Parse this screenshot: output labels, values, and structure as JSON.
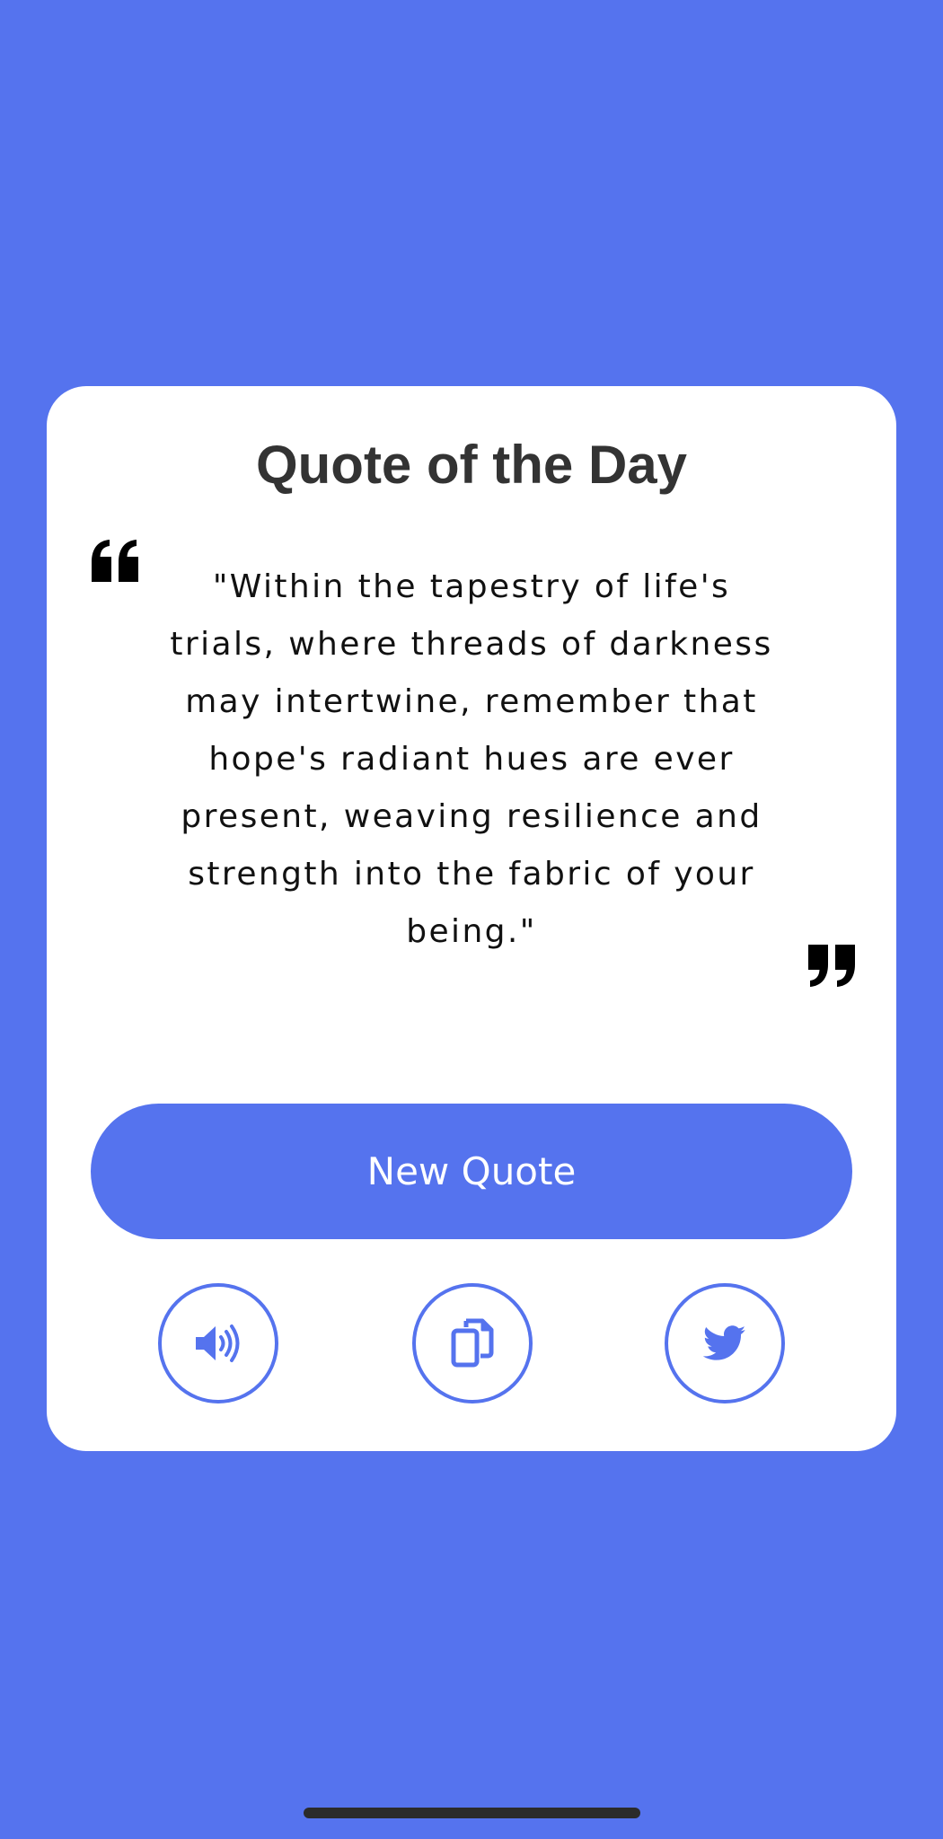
{
  "colors": {
    "background": "#5573ee",
    "card": "#ffffff",
    "accent": "#5573ee",
    "title": "#333333",
    "quote_text": "#111111"
  },
  "card": {
    "title": "Quote of the Day",
    "quote": "\"Within the tapestry of life's trials, where threads of darkness may intertwine, remember that hope's radiant hues are ever present, weaving resilience and strength into the fabric of your being.\"",
    "open_quote_icon": "quote-left-icon",
    "close_quote_icon": "quote-right-icon"
  },
  "actions": {
    "new_quote_label": "New Quote",
    "speak_icon": "speaker-icon",
    "copy_icon": "copy-icon",
    "tweet_icon": "twitter-icon"
  }
}
